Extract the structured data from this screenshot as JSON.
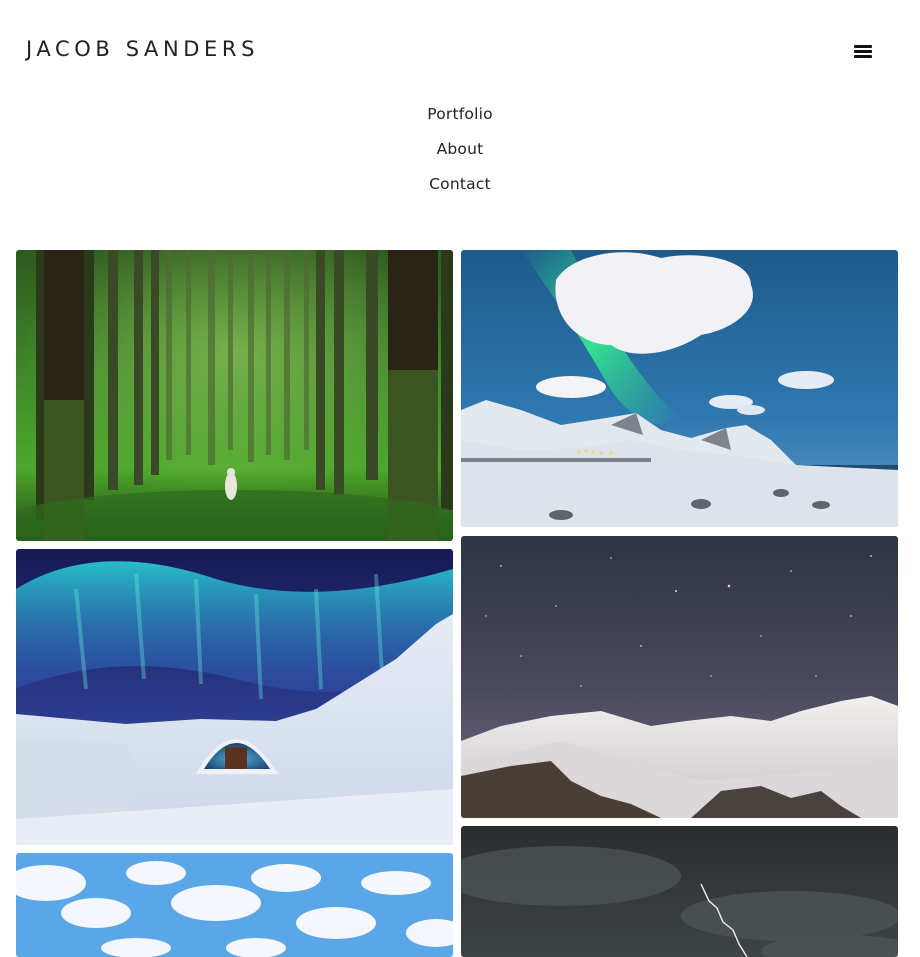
{
  "header": {
    "site_title": "JACOB SANDERS",
    "menu_icon": "hamburger-menu-icon"
  },
  "nav": {
    "items": [
      {
        "label": "Portfolio"
      },
      {
        "label": "About"
      },
      {
        "label": "Contact"
      }
    ]
  },
  "gallery": {
    "photos": [
      {
        "subject": "forest"
      },
      {
        "subject": "aurora-coast"
      },
      {
        "subject": "aurora-ice-hotel"
      },
      {
        "subject": "starry-mountains"
      },
      {
        "subject": "clouds-sky"
      },
      {
        "subject": "lightning-storm"
      }
    ]
  }
}
